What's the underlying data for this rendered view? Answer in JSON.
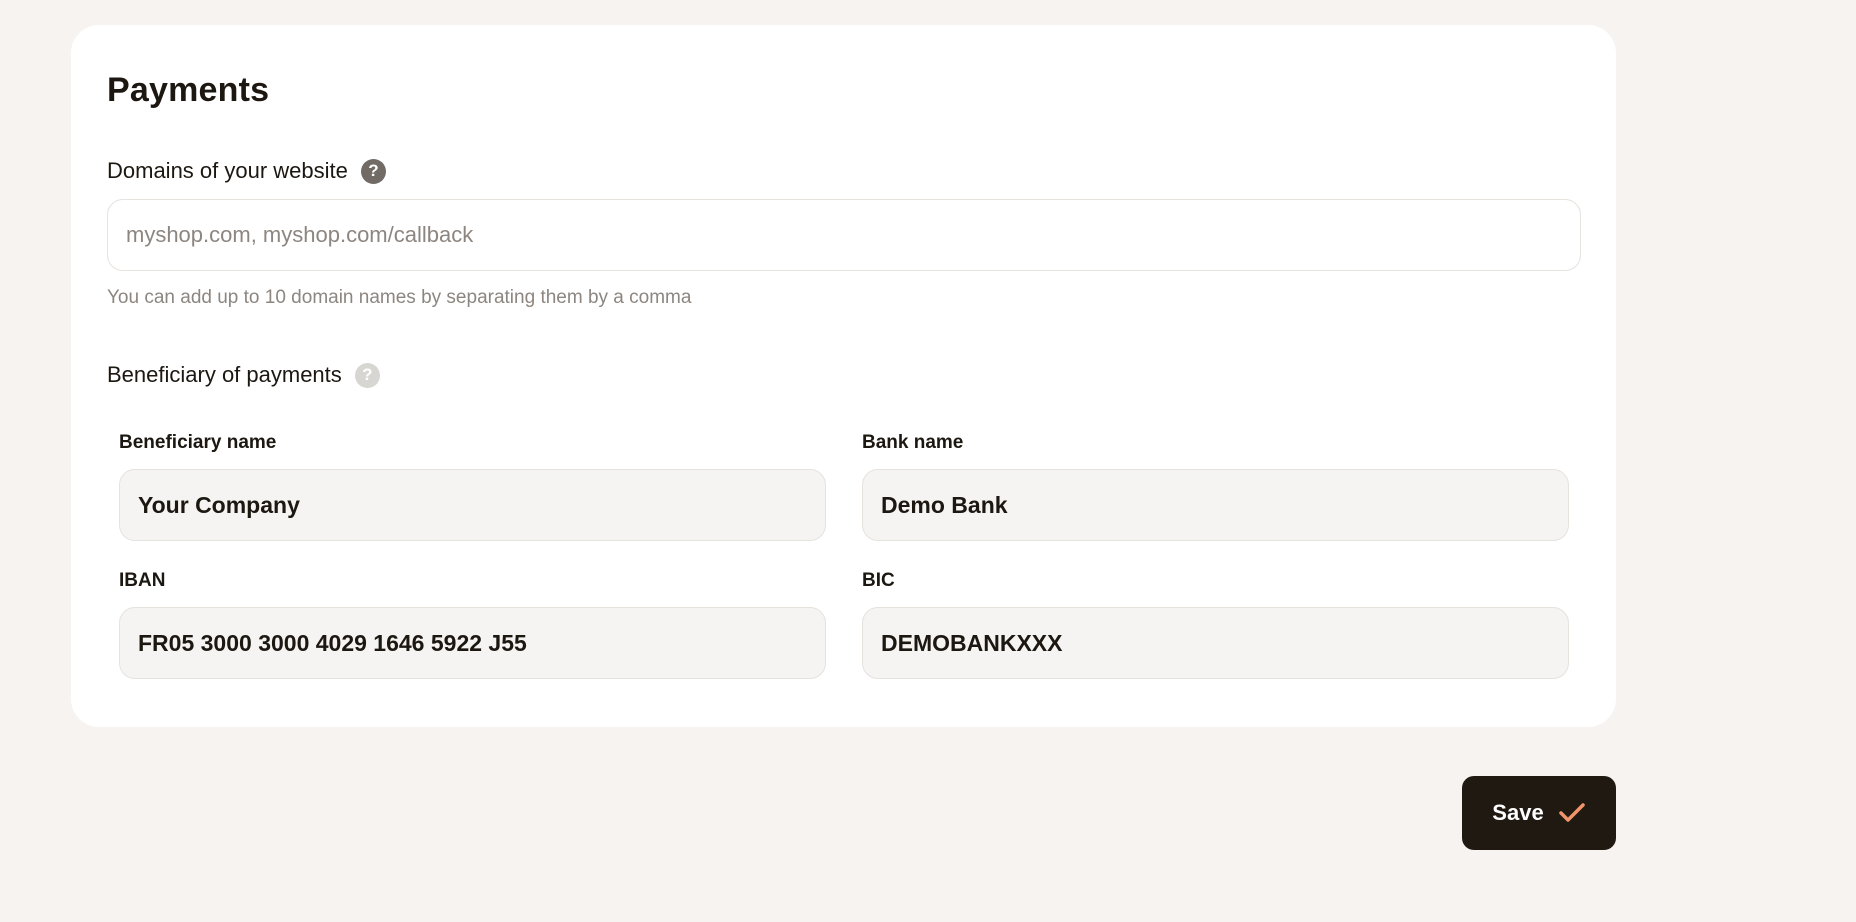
{
  "section": {
    "title": "Payments"
  },
  "domains": {
    "label": "Domains of your website",
    "placeholder": "myshop.com, myshop.com/callback",
    "hint": "You can add up to 10 domain names by separating them by a comma"
  },
  "beneficiary": {
    "label": "Beneficiary of payments",
    "fields": {
      "name": {
        "label": "Beneficiary name",
        "value": "Your Company"
      },
      "bank": {
        "label": "Bank name",
        "value": "Demo Bank"
      },
      "iban": {
        "label": "IBAN",
        "value": "FR05 3000 3000 4029 1646 5922 J55"
      },
      "bic": {
        "label": "BIC",
        "value": "DEMOBANKXXX"
      }
    }
  },
  "help_icon_glyph": "?",
  "actions": {
    "save_label": "Save",
    "save_icon": "check-icon",
    "accent": "#f0956b"
  }
}
